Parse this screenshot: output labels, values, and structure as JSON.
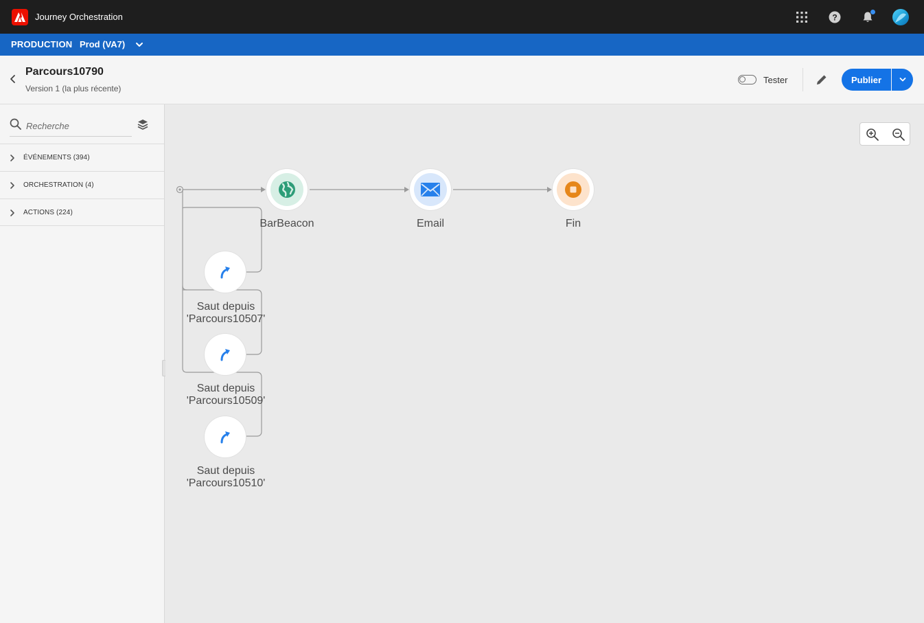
{
  "app": {
    "title": "Journey Orchestration"
  },
  "env": {
    "label": "PRODUCTION",
    "sandbox": "Prod (VA7)"
  },
  "header": {
    "title": "Parcours10790",
    "version": "Version 1 (la plus récente)",
    "test_label": "Tester",
    "publish_label": "Publier"
  },
  "sidebar": {
    "search_placeholder": "Recherche",
    "categories": [
      {
        "label": "ÉVÉNEMENTS (394)"
      },
      {
        "label": "ORCHESTRATION (4)"
      },
      {
        "label": "ACTIONS (224)"
      }
    ]
  },
  "canvas": {
    "nodes": {
      "barbeacon": {
        "label": "BarBeacon",
        "icon": "globe-icon",
        "color": "#2d9d78"
      },
      "email": {
        "label": "Email",
        "icon": "envelope-icon",
        "color": "#2680eb"
      },
      "end": {
        "label": "Fin",
        "icon": "stop-icon",
        "color": "#e68619"
      },
      "jumps": [
        {
          "line1": "Saut depuis",
          "line2": "'Parcours10507'"
        },
        {
          "line1": "Saut depuis",
          "line2": "'Parcours10509'"
        },
        {
          "line1": "Saut depuis",
          "line2": "'Parcours10510'"
        }
      ]
    }
  },
  "colors": {
    "top_bar": "#1e1e1e",
    "env_bar": "#1766c4",
    "accent": "#1473e6",
    "logo": "#eb1000"
  }
}
